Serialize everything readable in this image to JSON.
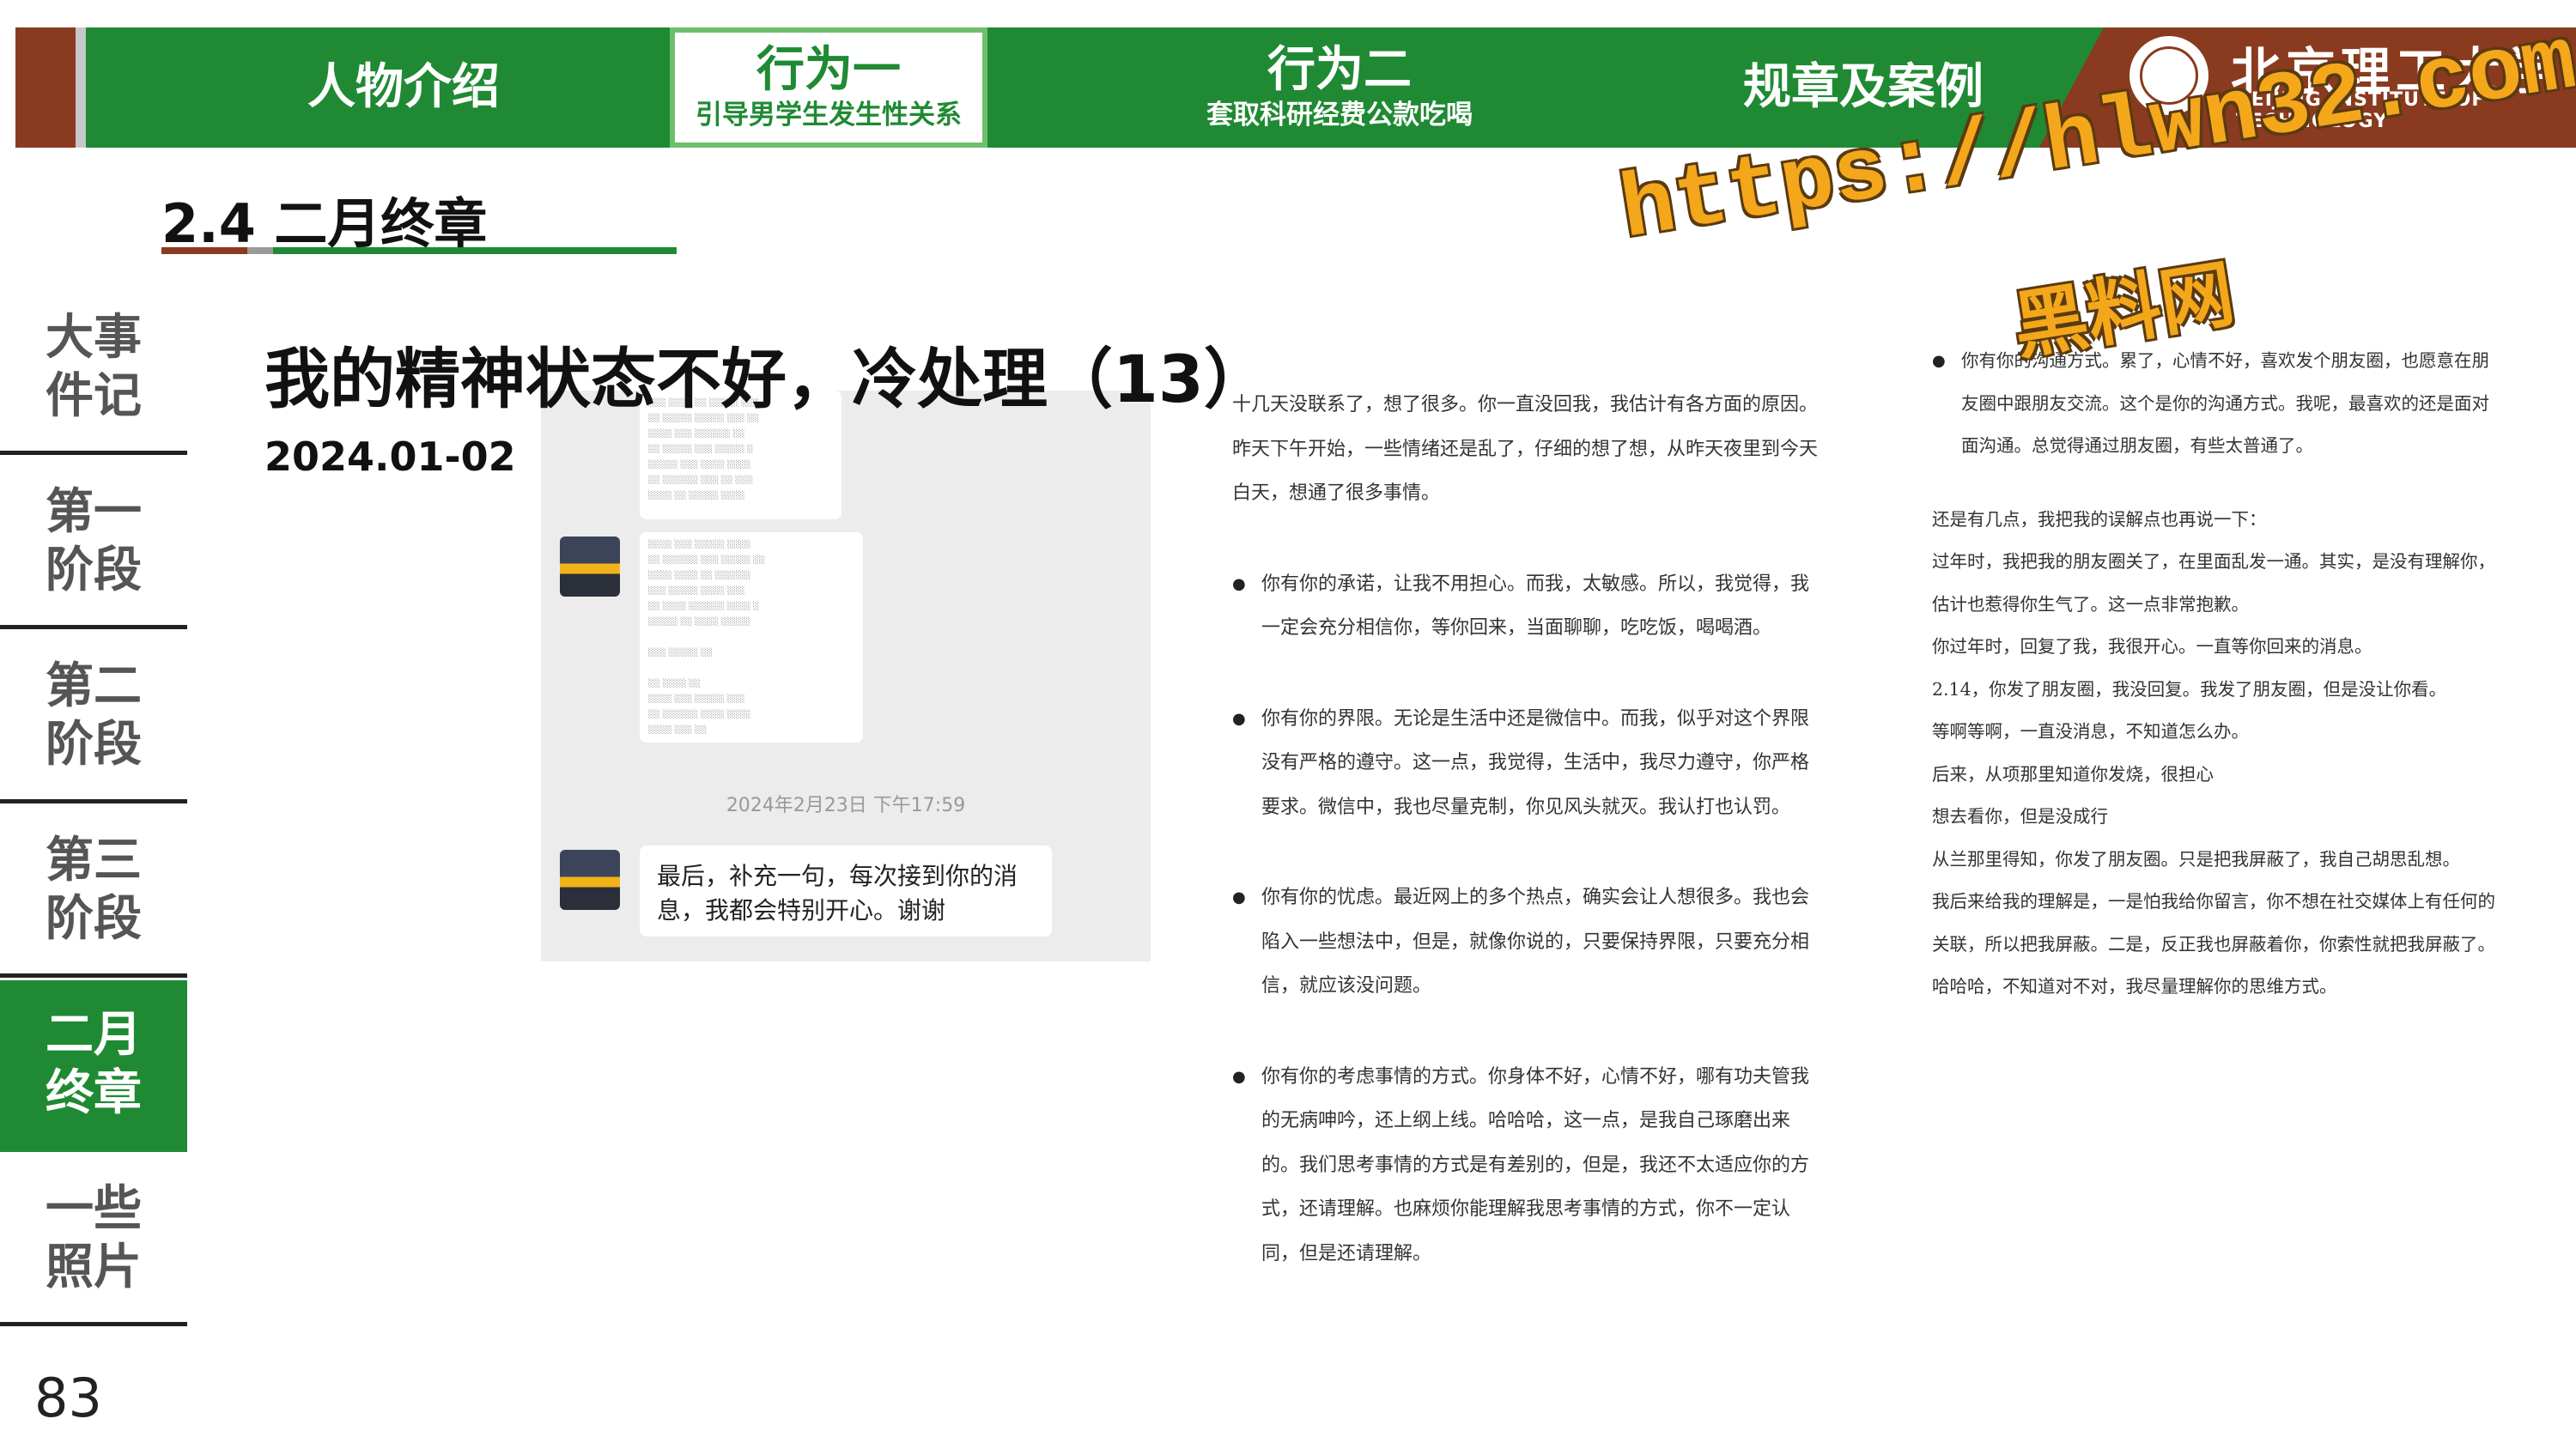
{
  "header": {
    "tabs": [
      {
        "main": "人物介绍",
        "sub": ""
      },
      {
        "main": "行为一",
        "sub": "引导男学生发生性关系"
      },
      {
        "main": "行为二",
        "sub": "套取科研经费公款吃喝"
      },
      {
        "main": "规章及案例",
        "sub": ""
      }
    ],
    "university_cn": "北京理工大学",
    "university_en": "BEIJING INSTITUTE OF TECHNOLOGY"
  },
  "section_title": "2.4 二月终章",
  "sidebar": {
    "items": [
      {
        "label": "大事\n件记"
      },
      {
        "label": "第一\n阶段"
      },
      {
        "label": "第二\n阶段"
      },
      {
        "label": "第三\n阶段"
      },
      {
        "label": "二月\n终章"
      },
      {
        "label": "一些\n照片"
      }
    ],
    "page_number": "83"
  },
  "slide": {
    "title": "我的精神状态不好，冷处理（13）",
    "date": "2024.01-02"
  },
  "chat": {
    "timestamp": "2024年2月23日 下午17:59",
    "last_message": "最后，补充一句，每次接到你的消息，我都会特别开心。谢谢"
  },
  "article_middle": {
    "intro": "十几天没联系了，想了很多。你一直没回我，我估计有各方面的原因。昨天下午开始，一些情绪还是乱了，仔细的想了想，从昨天夜里到今天白天，想通了很多事情。",
    "bullets": [
      "你有你的承诺，让我不用担心。而我，太敏感。所以，我觉得，我一定会充分相信你，等你回来，当面聊聊，吃吃饭，喝喝酒。",
      "你有你的界限。无论是生活中还是微信中。而我，似乎对这个界限没有严格的遵守。这一点，我觉得，生活中，我尽力遵守，你严格要求。微信中，我也尽量克制，你见风头就灭。我认打也认罚。",
      "你有你的忧虑。最近网上的多个热点，确实会让人想很多。我也会陷入一些想法中，但是，就像你说的，只要保持界限，只要充分相信，就应该没问题。",
      "你有你的考虑事情的方式。你身体不好，心情不好，哪有功夫管我的无病呻吟，还上纲上线。哈哈哈，这一点，是我自己琢磨出来的。我们思考事情的方式是有差别的，但是，我还不太适应你的方式，还请理解。也麻烦你能理解我思考事情的方式，你不一定认同，但是还请理解。"
    ]
  },
  "article_right": {
    "bullet": "你有你的沟通方式。累了，心情不好，喜欢发个朋友圈，也愿意在朋友圈中跟朋友交流。这个是你的沟通方式。我呢，最喜欢的还是面对面沟通。总觉得通过朋友圈，有些太普通了。",
    "lines": [
      "还是有几点，我把我的误解点也再说一下：",
      "过年时，我把我的朋友圈关了，在里面乱发一通。其实，是没有理解你，估计也惹得你生气了。这一点非常抱歉。",
      "你过年时，回复了我，我很开心。一直等你回来的消息。",
      "2.14，你发了朋友圈，我没回复。我发了朋友圈，但是没让你看。",
      "等啊等啊，一直没消息，不知道怎么办。",
      "后来，从项那里知道你发烧，很担心",
      "想去看你，但是没成行",
      "从兰那里得知，你发了朋友圈。只是把我屏蔽了，我自己胡思乱想。",
      "我后来给我的理解是，一是怕我给你留言，你不想在社交媒体上有任何的关联，所以把我屏蔽。二是，反正我也屏蔽着你，你索性就把我屏蔽了。哈哈哈，不知道对不对，我尽量理解你的思维方式。"
    ]
  },
  "watermark": {
    "url": "https://hlwn32.com",
    "name": "黑料网"
  },
  "colors": {
    "green": "#1f8a33",
    "brown": "#8a3a1e",
    "watermark": "#f4a71b"
  }
}
